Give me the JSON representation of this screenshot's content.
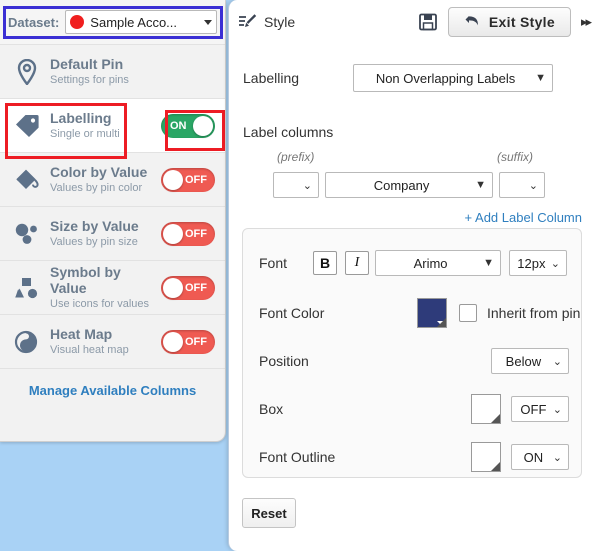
{
  "sidebar": {
    "dataset": {
      "label": "Dataset:",
      "value": "Sample Acco...",
      "dot_color": "#f01f1f"
    },
    "items": [
      {
        "icon": "map-pin-icon",
        "title": "Default Pin",
        "subtitle": "Settings for pins",
        "toggle": null,
        "active": false
      },
      {
        "icon": "tag-icon",
        "title": "Labelling",
        "subtitle": "Single or multi",
        "toggle": "ON",
        "active": true
      },
      {
        "icon": "paint-bucket-icon",
        "title": "Color by Value",
        "subtitle": "Values by pin color",
        "toggle": "OFF",
        "active": false
      },
      {
        "icon": "size-circles-icon",
        "title": "Size by Value",
        "subtitle": "Values by pin size",
        "toggle": "OFF",
        "active": false
      },
      {
        "icon": "symbol-shapes-icon",
        "title": "Symbol by Value",
        "subtitle": "Use icons for values",
        "toggle": "OFF",
        "active": false
      },
      {
        "icon": "heat-map-icon",
        "title": "Heat Map",
        "subtitle": "Visual heat map",
        "toggle": "OFF",
        "active": false
      }
    ],
    "manage_link": "Manage Available Columns"
  },
  "panel": {
    "header": {
      "brush_icon": "paint-brush-icon",
      "title": "Style",
      "save_icon": "save-floppy-icon",
      "exit_icon": "undo-arrow-icon",
      "exit_label": "Exit Style",
      "collapse_icon": "double-chevron-right-icon"
    },
    "labelling": {
      "label": "Labelling",
      "value": "Non Overlapping Labels"
    },
    "label_columns": {
      "label": "Label columns",
      "prefix_hint": "(prefix)",
      "suffix_hint": "(suffix)",
      "prefix_value": "",
      "column_value": "Company",
      "suffix_value": "",
      "add_link": "+ Add Label Column"
    },
    "font": {
      "label": "Font",
      "bold_label": "B",
      "italic_label": "I",
      "family": "Arimo",
      "size": "12px"
    },
    "font_color": {
      "label": "Font Color",
      "swatch_color": "#2e3b7a",
      "inherit_label": "Inherit from pin",
      "inherit_checked": false
    },
    "position": {
      "label": "Position",
      "value": "Below"
    },
    "box": {
      "label": "Box",
      "swatch_color": "#ffffff",
      "value": "OFF"
    },
    "font_outline": {
      "label": "Font Outline",
      "swatch_color": "#ffffff",
      "value": "ON"
    },
    "reset_label": "Reset"
  },
  "annotations": {
    "dataset_box_color": "#3b2fd4",
    "labelling_box_color": "#ed1c24",
    "toggle_box_color": "#ed1c24"
  }
}
